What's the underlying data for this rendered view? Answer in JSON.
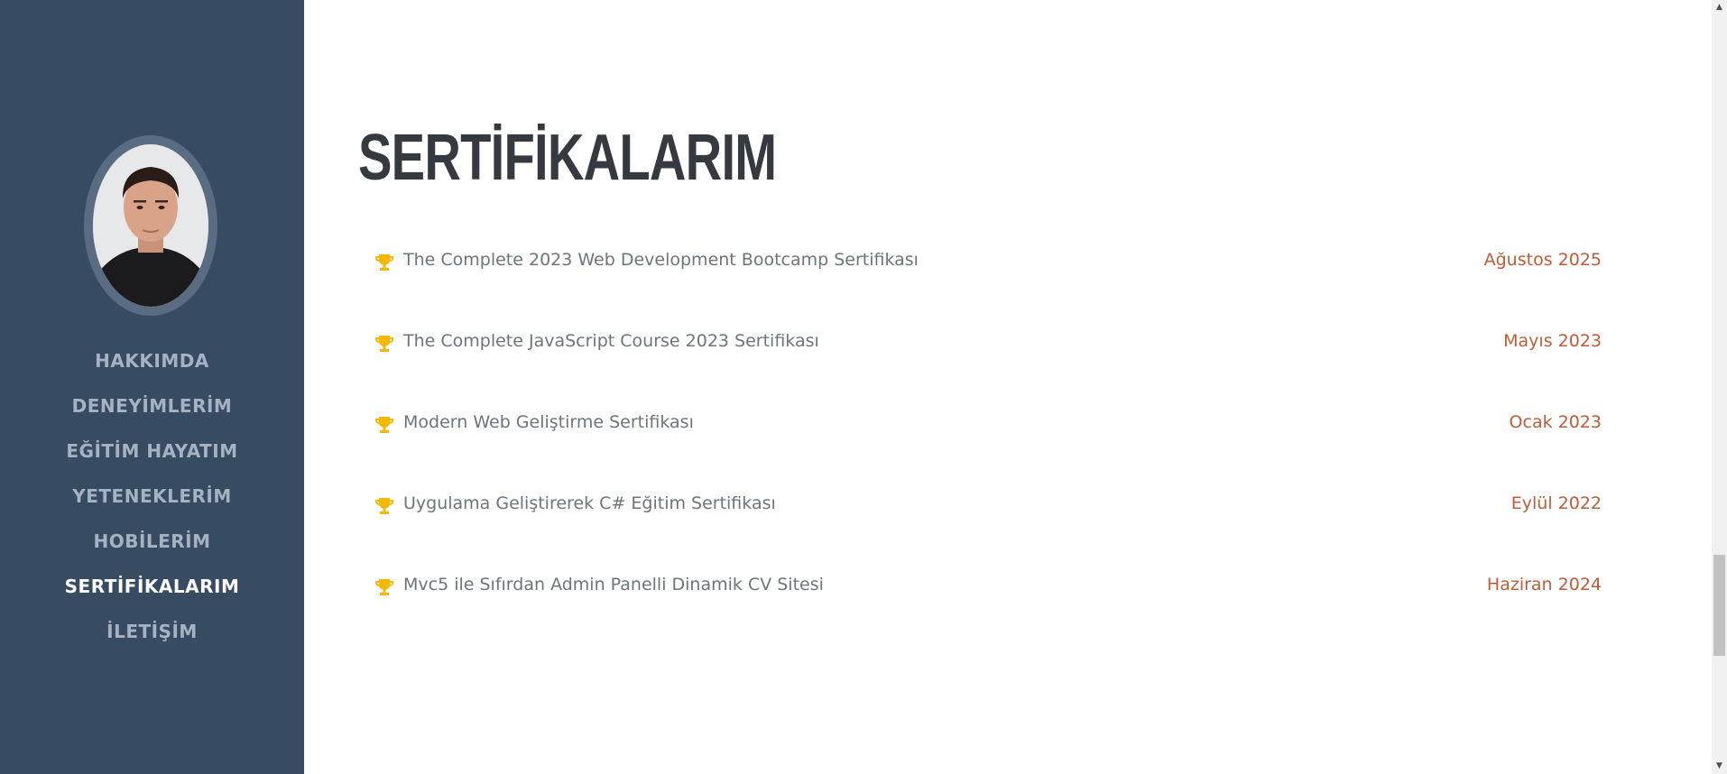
{
  "sidebar": {
    "nav": [
      {
        "label": "HAKKIMDA",
        "active": false
      },
      {
        "label": "DENEYİMLERİM",
        "active": false
      },
      {
        "label": "EĞİTİM HAYATIM",
        "active": false
      },
      {
        "label": "YETENEKLERİM",
        "active": false
      },
      {
        "label": "HOBİLERİM",
        "active": false
      },
      {
        "label": "SERTİFİKALARIM",
        "active": true
      },
      {
        "label": "İLETİŞİM",
        "active": false
      }
    ]
  },
  "main": {
    "title": "SERTİFİKALARIM",
    "certificates": [
      {
        "icon": "trophy-icon",
        "name": "The Complete 2023 Web Development Bootcamp Sertifikası",
        "date": "Ağustos 2025"
      },
      {
        "icon": "trophy-icon",
        "name": "The Complete JavaScript Course 2023 Sertifikası",
        "date": "Mayıs 2023"
      },
      {
        "icon": "trophy-icon",
        "name": "Modern Web Geliştirme Sertifikası",
        "date": "Ocak 2023"
      },
      {
        "icon": "trophy-icon",
        "name": "Uygulama Geliştirerek C# Eğitim Sertifikası",
        "date": "Eylül 2022"
      },
      {
        "icon": "trophy-icon",
        "name": "Mvc5 ile Sıfırdan Admin Panelli Dinamik CV Sitesi",
        "date": "Haziran 2024"
      }
    ]
  },
  "colors": {
    "sidebar_bg": "#374c63",
    "nav_text": "#a6b2c1",
    "nav_active": "#ffffff",
    "title": "#343a40",
    "cert_text": "#6c757d",
    "date_text": "#bd5d38",
    "trophy": "#f5b800"
  }
}
